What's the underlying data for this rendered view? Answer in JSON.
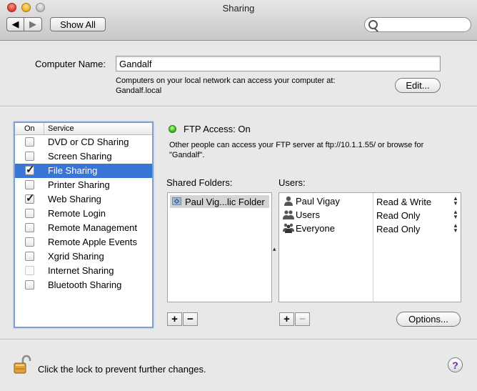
{
  "window": {
    "title": "Sharing"
  },
  "toolbar": {
    "back_icon": "◀",
    "forward_icon": "▶",
    "show_all_label": "Show All",
    "search": {
      "value": "",
      "placeholder": ""
    }
  },
  "computer_name": {
    "label": "Computer Name:",
    "value": "Gandalf",
    "description_line1": "Computers on your local network can access your computer at:",
    "description_line2": "Gandalf.local",
    "edit_label": "Edit..."
  },
  "services": {
    "header_on": "On",
    "header_service": "Service",
    "items": [
      {
        "label": "DVD or CD Sharing",
        "checked": false,
        "selected": false,
        "enabled": true
      },
      {
        "label": "Screen Sharing",
        "checked": false,
        "selected": false,
        "enabled": true
      },
      {
        "label": "File Sharing",
        "checked": true,
        "selected": true,
        "enabled": true
      },
      {
        "label": "Printer Sharing",
        "checked": false,
        "selected": false,
        "enabled": true
      },
      {
        "label": "Web Sharing",
        "checked": true,
        "selected": false,
        "enabled": true
      },
      {
        "label": "Remote Login",
        "checked": false,
        "selected": false,
        "enabled": true
      },
      {
        "label": "Remote Management",
        "checked": false,
        "selected": false,
        "enabled": true
      },
      {
        "label": "Remote Apple Events",
        "checked": false,
        "selected": false,
        "enabled": true
      },
      {
        "label": "Xgrid Sharing",
        "checked": false,
        "selected": false,
        "enabled": true
      },
      {
        "label": "Internet Sharing",
        "checked": false,
        "selected": false,
        "enabled": false
      },
      {
        "label": "Bluetooth Sharing",
        "checked": false,
        "selected": false,
        "enabled": true
      }
    ]
  },
  "detail": {
    "status_color": "#3fc22a",
    "status_text": "FTP Access: On",
    "description_line1": "Other people can access your FTP server at ftp://10.1.1.55/ or browse for",
    "description_line2": "\"Gandalf\".",
    "shared_folders_label": "Shared Folders:",
    "users_label": "Users:",
    "shared_folders": [
      {
        "name": "Paul Vig...lic Folder",
        "icon": "public-folder-icon"
      }
    ],
    "users": [
      {
        "name": "Paul Vigay",
        "icon": "single-user-icon",
        "permission": "Read & Write"
      },
      {
        "name": "Users",
        "icon": "group-icon",
        "permission": "Read Only"
      },
      {
        "name": "Everyone",
        "icon": "everyone-icon",
        "permission": "Read Only"
      }
    ],
    "add_label": "+",
    "remove_label": "−",
    "options_label": "Options..."
  },
  "footer": {
    "lock_text": "Click the lock to prevent further changes.",
    "help_label": "?"
  }
}
